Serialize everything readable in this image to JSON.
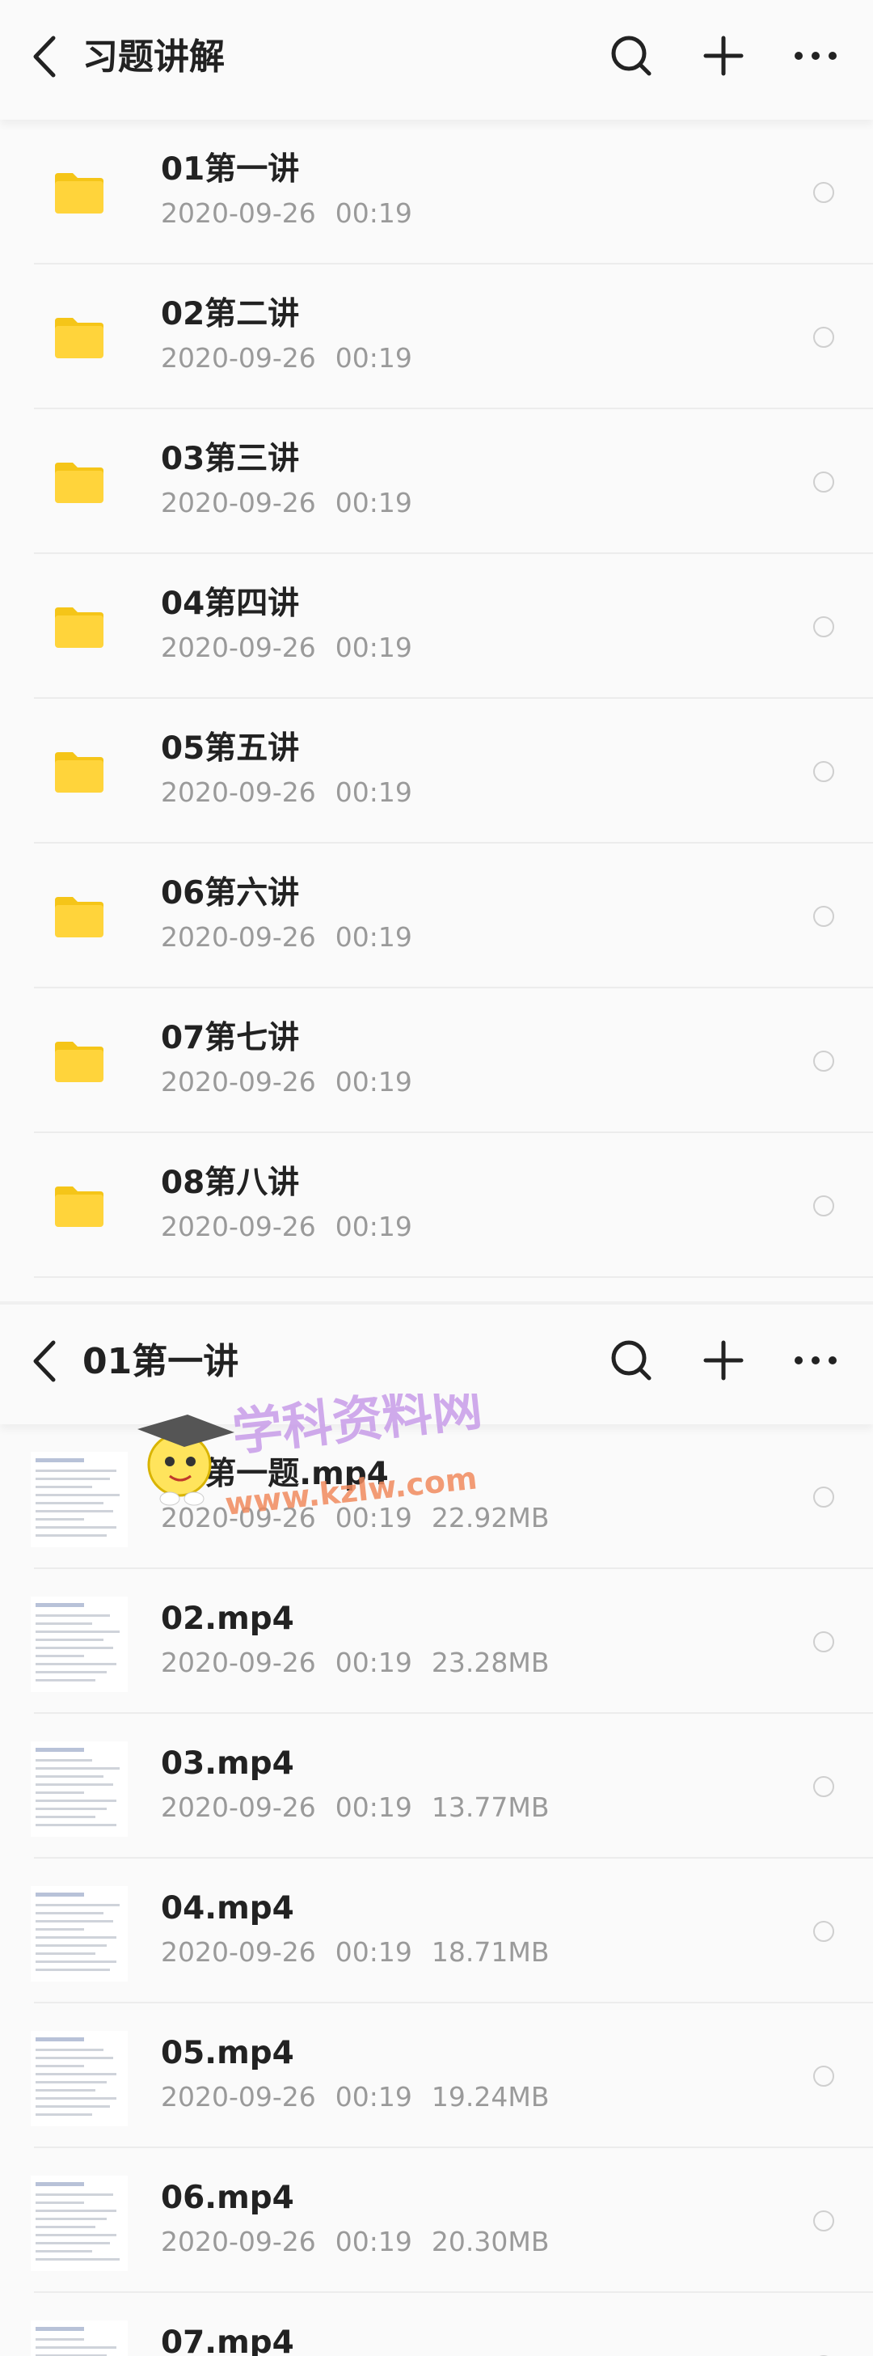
{
  "screens": [
    {
      "title": "习题讲解",
      "icons": {
        "back": "chevron-left-icon",
        "search": "search-icon",
        "add": "plus-icon",
        "more": "more-horizontal-icon",
        "item": "folder-icon"
      },
      "items": [
        {
          "name": "01第一讲",
          "date": "2020-09-26",
          "time": "00:19"
        },
        {
          "name": "02第二讲",
          "date": "2020-09-26",
          "time": "00:19"
        },
        {
          "name": "03第三讲",
          "date": "2020-09-26",
          "time": "00:19"
        },
        {
          "name": "04第四讲",
          "date": "2020-09-26",
          "time": "00:19"
        },
        {
          "name": "05第五讲",
          "date": "2020-09-26",
          "time": "00:19"
        },
        {
          "name": "06第六讲",
          "date": "2020-09-26",
          "time": "00:19"
        },
        {
          "name": "07第七讲",
          "date": "2020-09-26",
          "time": "00:19"
        },
        {
          "name": "08第八讲",
          "date": "2020-09-26",
          "time": "00:19"
        }
      ]
    },
    {
      "title": "01第一讲",
      "icons": {
        "back": "chevron-left-icon",
        "search": "search-icon",
        "add": "plus-icon",
        "more": "more-horizontal-icon",
        "item": "video-thumbnail"
      },
      "items": [
        {
          "name": "01第一题.mp4",
          "date": "2020-09-26",
          "time": "00:19",
          "size": "22.92MB"
        },
        {
          "name": "02.mp4",
          "date": "2020-09-26",
          "time": "00:19",
          "size": "23.28MB"
        },
        {
          "name": "03.mp4",
          "date": "2020-09-26",
          "time": "00:19",
          "size": "13.77MB"
        },
        {
          "name": "04.mp4",
          "date": "2020-09-26",
          "time": "00:19",
          "size": "18.71MB"
        },
        {
          "name": "05.mp4",
          "date": "2020-09-26",
          "time": "00:19",
          "size": "19.24MB"
        },
        {
          "name": "06.mp4",
          "date": "2020-09-26",
          "time": "00:19",
          "size": "20.30MB"
        },
        {
          "name": "07.mp4",
          "date": "",
          "time": "",
          "size": ""
        }
      ]
    }
  ],
  "watermark": {
    "text_cn": "学科资料网",
    "text_url": "www.kzlw.com"
  },
  "colors": {
    "folder": "#FFD43B",
    "folder_tab": "#F5C518",
    "title_text": "#222222",
    "meta_text": "#9A9A9A",
    "watermark_cn": "#C79BE8",
    "watermark_url": "#F08A5D"
  }
}
